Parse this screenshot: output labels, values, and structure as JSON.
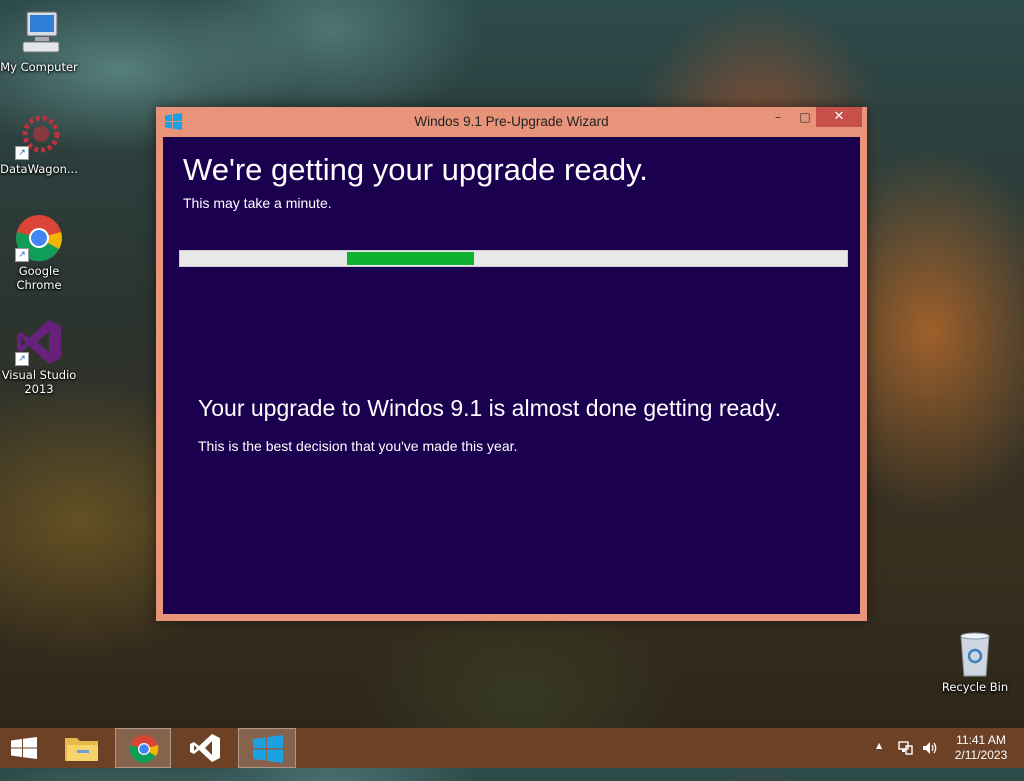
{
  "desktop": {
    "icons": [
      {
        "label": "My Computer",
        "icon": "computer-icon"
      },
      {
        "label": "DataWagon...",
        "icon": "datawagon-icon"
      },
      {
        "label": "Google Chrome",
        "icon": "chrome-icon"
      },
      {
        "label": "Visual Studio 2013",
        "icon": "visual-studio-icon"
      },
      {
        "label": "Recycle Bin",
        "icon": "recycle-bin-icon"
      }
    ]
  },
  "window": {
    "title": "Windos 9.1 Pre-Upgrade Wizard",
    "minimize": "–",
    "maximize": "□",
    "close": "✕",
    "heading": "We're getting your upgrade ready.",
    "subheading": "This may take a minute.",
    "progress": {
      "start": 0.25,
      "end": 0.44,
      "color": "#10b030"
    },
    "message": "Your upgrade to Windos 9.1 is almost done getting ready.",
    "message_sub": "This is the best decision that you've made this year."
  },
  "taskbar": {
    "items": [
      "start-button",
      "file-explorer",
      "chrome",
      "visual-studio",
      "windows-app"
    ],
    "tray": {
      "chevron": "▲"
    },
    "clock": {
      "time": "11:41 AM",
      "date": "2/11/2023"
    }
  },
  "colors": {
    "window_border": "#e8947a",
    "content_bg": "#1b0050",
    "close": "#c7504b"
  }
}
